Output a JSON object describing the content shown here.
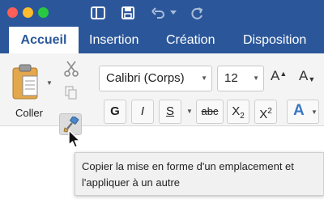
{
  "colors": {
    "accent": "#2b579a",
    "ribbon": "#f4f4f4",
    "tooltip_bg": "#f1f1f1"
  },
  "titlebar": {
    "icons": [
      "sidebar-icon",
      "save-icon",
      "undo-icon",
      "chevron-down-icon",
      "redo-icon"
    ]
  },
  "tabs": [
    {
      "label": "Accueil",
      "active": true
    },
    {
      "label": "Insertion",
      "active": false
    },
    {
      "label": "Création",
      "active": false
    },
    {
      "label": "Disposition",
      "active": false
    }
  ],
  "clipboard": {
    "paste_label": "Coller"
  },
  "font": {
    "family": "Calibri (Corps)",
    "size": "12",
    "grow_label": "A",
    "shrink_label": "A"
  },
  "format": {
    "bold": "G",
    "italic": "I",
    "underline": "S",
    "strike": "abc",
    "subscript_base": "X",
    "subscript_sub": "2",
    "superscript_base": "X",
    "superscript_sup": "2",
    "effects": "A"
  },
  "tooltip": {
    "line1": "Copier la mise en forme d'un emplacement et",
    "line2": "l'appliquer à un autre"
  }
}
